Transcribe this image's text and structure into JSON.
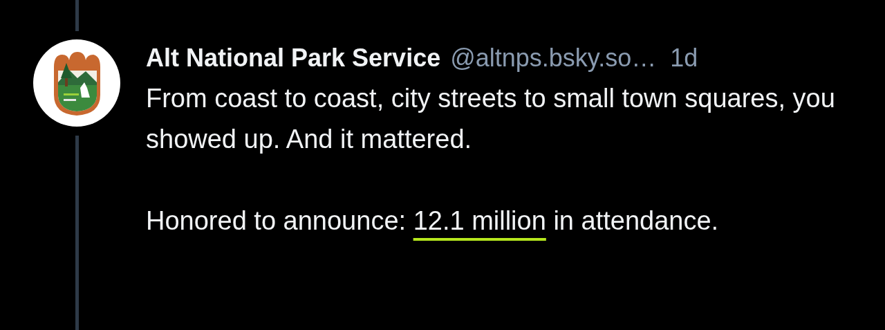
{
  "post": {
    "author": {
      "display_name": "Alt National Park Service",
      "handle": "@altnps.bsky.so…"
    },
    "time": "1d",
    "paragraphs": [
      [
        {
          "kind": "text",
          "text": "From coast to coast, city streets to small town squares, you showed up. And it mattered."
        }
      ],
      [
        {
          "kind": "text",
          "text": "Honored to announce: "
        },
        {
          "kind": "highlight",
          "text": "12.1 million"
        },
        {
          "kind": "text",
          "text": " in attendance."
        }
      ]
    ]
  }
}
